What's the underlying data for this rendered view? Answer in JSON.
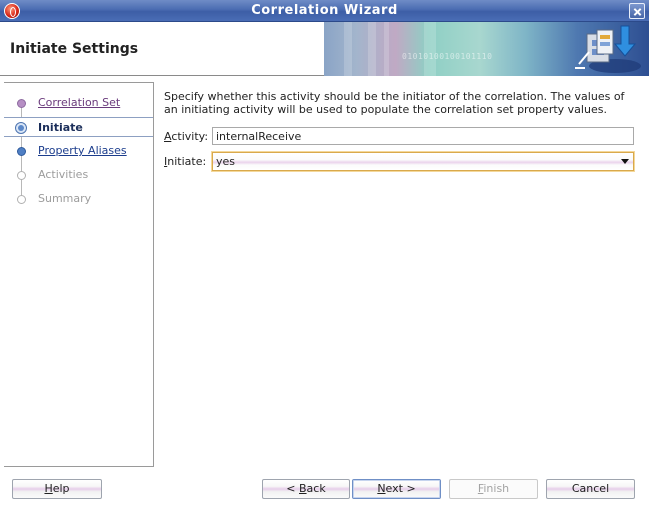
{
  "window": {
    "title": "Correlation Wizard"
  },
  "header": {
    "title": "Initiate Settings",
    "banner_text": "01010100100101110"
  },
  "nav": {
    "items": [
      {
        "label": "Correlation Set",
        "state": "visited"
      },
      {
        "label": "Initiate",
        "state": "current"
      },
      {
        "label": "Property Aliases",
        "state": "link"
      },
      {
        "label": "Activities",
        "state": "disabled"
      },
      {
        "label": "Summary",
        "state": "disabled"
      }
    ]
  },
  "main": {
    "description": "Specify whether this activity should be the initiator of the correlation. The values of an initiating activity will be used to populate the correlation set property values.",
    "activity": {
      "label_mnemonic": "A",
      "label_rest": "ctivity:",
      "value": "internalReceive"
    },
    "initiate": {
      "label_mnemonic": "I",
      "label_rest": "nitiate:",
      "value": "yes"
    }
  },
  "footer": {
    "help": {
      "mnemonic": "H",
      "rest": "elp"
    },
    "back": {
      "prefix": "< ",
      "mnemonic": "B",
      "rest": "ack"
    },
    "next": {
      "mnemonic": "N",
      "rest": "ext >"
    },
    "finish": {
      "mnemonic": "F",
      "rest": "inish"
    },
    "cancel": {
      "label": "Cancel"
    }
  },
  "colors": {
    "titlebar": "#4b6cb2",
    "visited_link": "#6a3a7c",
    "link": "#1b3c8c",
    "focus_border": "#d9a94c"
  },
  "icons": {
    "app": "oracle-icon",
    "close": "close-icon",
    "wizard": "correlation-wizard-icon"
  }
}
